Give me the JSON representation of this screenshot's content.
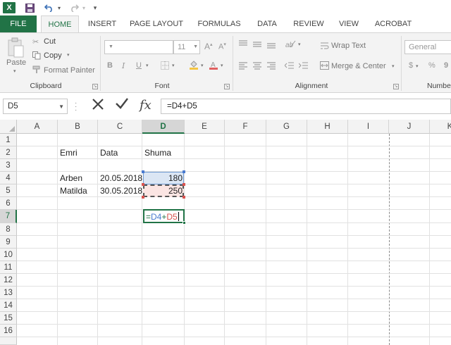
{
  "titlebar": {
    "app_logo": "X",
    "icons": [
      "save-icon",
      "undo-icon",
      "redo-icon",
      "customize-quick-access-icon"
    ]
  },
  "tabs": [
    "FILE",
    "HOME",
    "INSERT",
    "PAGE LAYOUT",
    "FORMULAS",
    "DATA",
    "REVIEW",
    "VIEW",
    "ACROBAT"
  ],
  "ribbon": {
    "clipboard": {
      "label": "Clipboard",
      "paste": "Paste",
      "cut": "Cut",
      "copy": "Copy",
      "format_painter": "Format Painter"
    },
    "font": {
      "label": "Font",
      "font_size": "11",
      "bold": "B",
      "italic": "I",
      "underline": "U"
    },
    "alignment": {
      "label": "Alignment",
      "wrap_text": "Wrap Text",
      "merge_center": "Merge & Center"
    },
    "number": {
      "label": "Numbe",
      "format": "General",
      "currency": "$",
      "percent": "%",
      "comma": "9"
    }
  },
  "formula_bar": {
    "name_box": "D5",
    "formula": "=D4+D5",
    "fx": "fx"
  },
  "sheet": {
    "columns": [
      "A",
      "B",
      "C",
      "D",
      "E",
      "F",
      "G",
      "H",
      "I",
      "J",
      "K"
    ],
    "active_column": "D",
    "rows": [
      "1",
      "2",
      "3",
      "4",
      "5",
      "6",
      "7",
      "8",
      "9",
      "10",
      "11",
      "12",
      "13",
      "14",
      "15",
      "16"
    ],
    "active_row": "7",
    "cells": {
      "B2": "Emri",
      "C2": "Data",
      "D2": "Shuma",
      "B4": "Arben",
      "C4": "20.05.2018",
      "D4": "180",
      "B5": "Matilda",
      "C5": "30.05.2018",
      "D5": "250"
    },
    "editing_cell": {
      "ref": "D7",
      "parts": [
        {
          "text": "=",
          "color": "#217346"
        },
        {
          "text": "D4",
          "color": "#4a7bd0"
        },
        {
          "text": "+",
          "color": "#217346"
        },
        {
          "text": "D5",
          "color": "#d9534f"
        }
      ]
    }
  },
  "colors": {
    "accent": "#217346",
    "ref_blue": "#4a7bd0",
    "ref_red": "#d9534f"
  }
}
